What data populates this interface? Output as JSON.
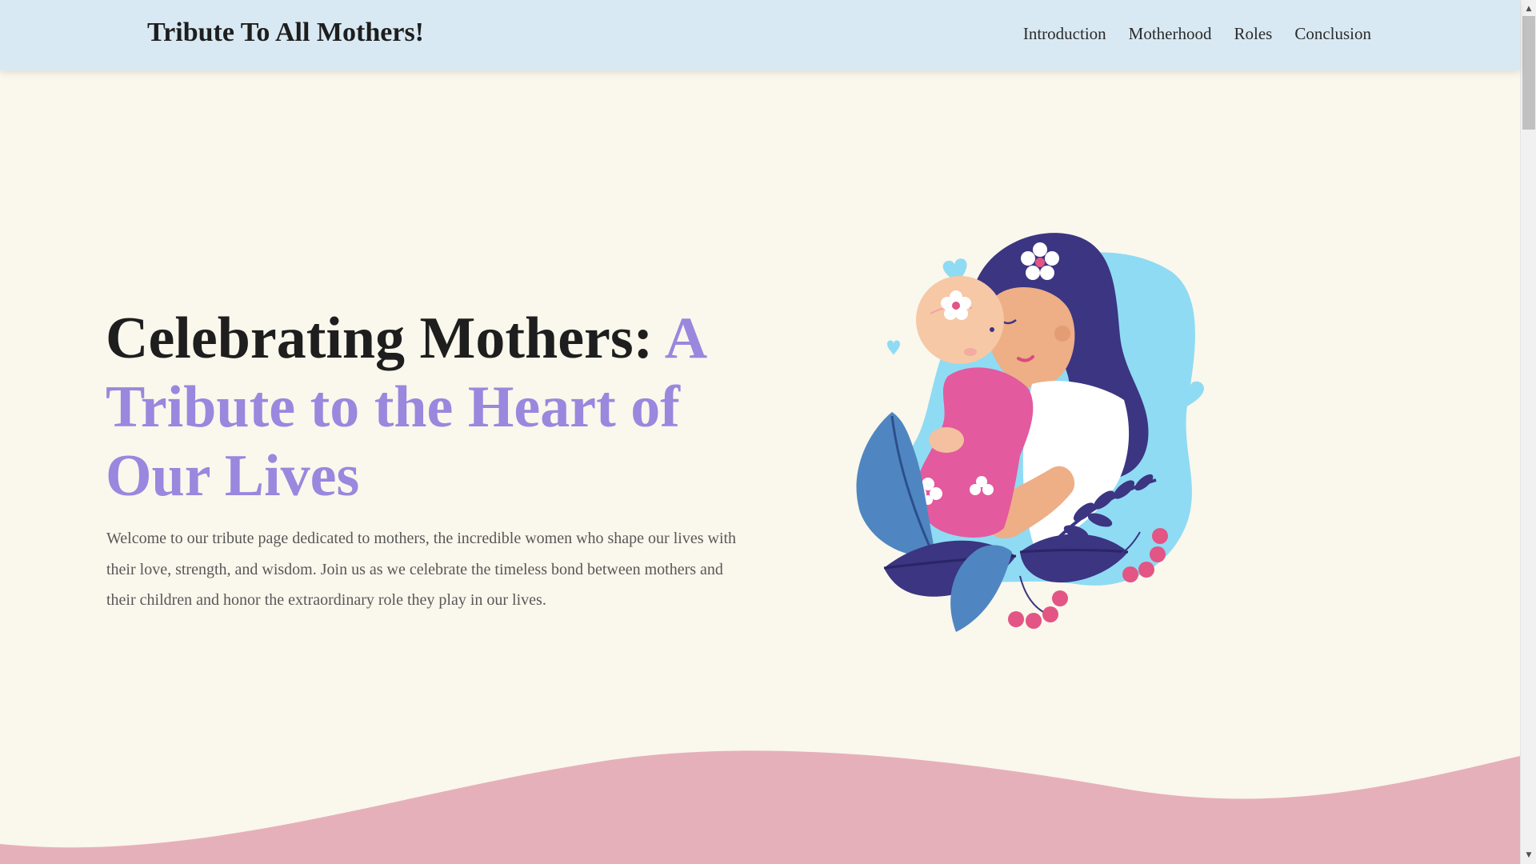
{
  "header": {
    "brand": "Tribute To All Mothers!",
    "nav": [
      {
        "label": "Introduction"
      },
      {
        "label": "Motherhood"
      },
      {
        "label": "Roles"
      },
      {
        "label": "Conclusion"
      }
    ]
  },
  "hero": {
    "title_dark": "Celebrating Mothers: ",
    "title_accent": "A Tribute to the Heart of Our Lives",
    "description": "Welcome to our tribute page dedicated to mothers, the incredible women who shape our lives with their love, strength, and wisdom. Join us as we celebrate the timeless bond between mothers and their children and honor the extraordinary role they play in our lives."
  },
  "illustration": {
    "icon": "mother-and-baby-illustration"
  },
  "colors": {
    "header_bg": "#d8e9f3",
    "page_bg": "#faf7ec",
    "accent": "#9a87de",
    "wave": "#e6b0ba"
  }
}
